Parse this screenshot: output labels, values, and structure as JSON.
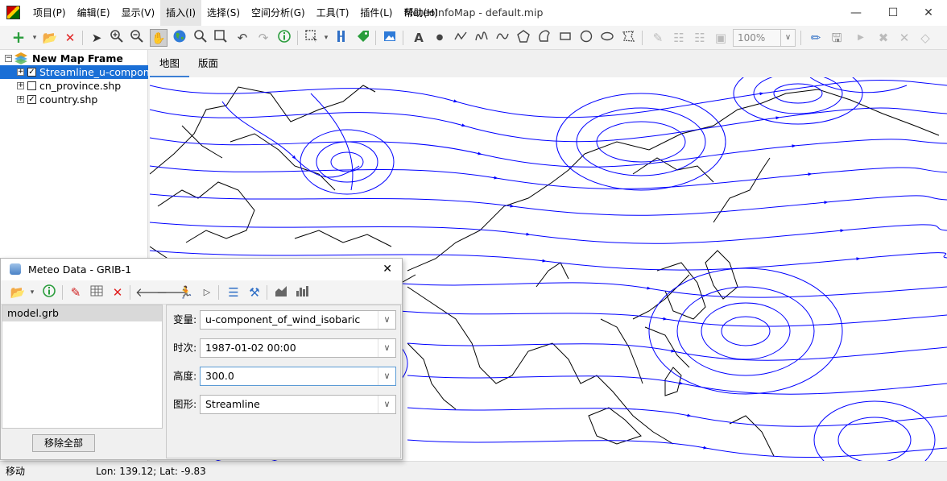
{
  "app": {
    "window_title": "MeteoInfoMap - default.mip",
    "menus": [
      "项目(P)",
      "编辑(E)",
      "显示(V)",
      "插入(I)",
      "选择(S)",
      "空间分析(G)",
      "工具(T)",
      "插件(L)",
      "帮助(H)"
    ],
    "active_menu": "插入(I)"
  },
  "toolbar": {
    "zoom_level": "100%",
    "icons": [
      "add-layer-icon",
      "open-folder-icon",
      "remove-layer-icon",
      "select-pointer-icon",
      "zoom-in-icon",
      "zoom-out-icon",
      "pan-hand-icon",
      "full-extent-globe-icon",
      "magnifier-icon",
      "zoom-selection-icon",
      "undo-icon",
      "redo-icon",
      "identify-icon",
      "select-features-icon",
      "measure-icon",
      "label-icon",
      "picture-icon",
      "text-icon",
      "point-icon",
      "polyline-icon",
      "freehand-icon",
      "curve-icon",
      "polygon-icon",
      "curve-polygon-icon",
      "rectangle-icon",
      "circle-icon",
      "ellipse-icon",
      "freehand-polygon-icon",
      "edit-pen-icon",
      "save-icon"
    ]
  },
  "layers": {
    "frame_name": "New Map Frame",
    "items": [
      {
        "name": "Streamline_u-compone",
        "checked": true,
        "selected": true
      },
      {
        "name": "cn_province.shp",
        "checked": false,
        "selected": false
      },
      {
        "name": "country.shp",
        "checked": true,
        "selected": false
      }
    ]
  },
  "tabs": [
    {
      "label": "地图",
      "active": true
    },
    {
      "label": "版面",
      "active": false
    }
  ],
  "map": {
    "streamline_color": "#0000ff",
    "coastline_color": "#000000"
  },
  "meteo_dialog": {
    "title": "Meteo Data - GRIB-1",
    "close_symbol": "✕",
    "files": [
      "model.grb"
    ],
    "remove_all_label": "移除全部",
    "fields": [
      {
        "label": "变量:",
        "value": "u-component_of_wind_isobaric"
      },
      {
        "label": "时次:",
        "value": "1987-01-02 00:00"
      },
      {
        "label": "高度:",
        "value": "300.0"
      },
      {
        "label": "图形:",
        "value": "Streamline"
      }
    ]
  },
  "status": {
    "mode": "移动",
    "coords": "Lon: 139.12; Lat: -9.83"
  }
}
